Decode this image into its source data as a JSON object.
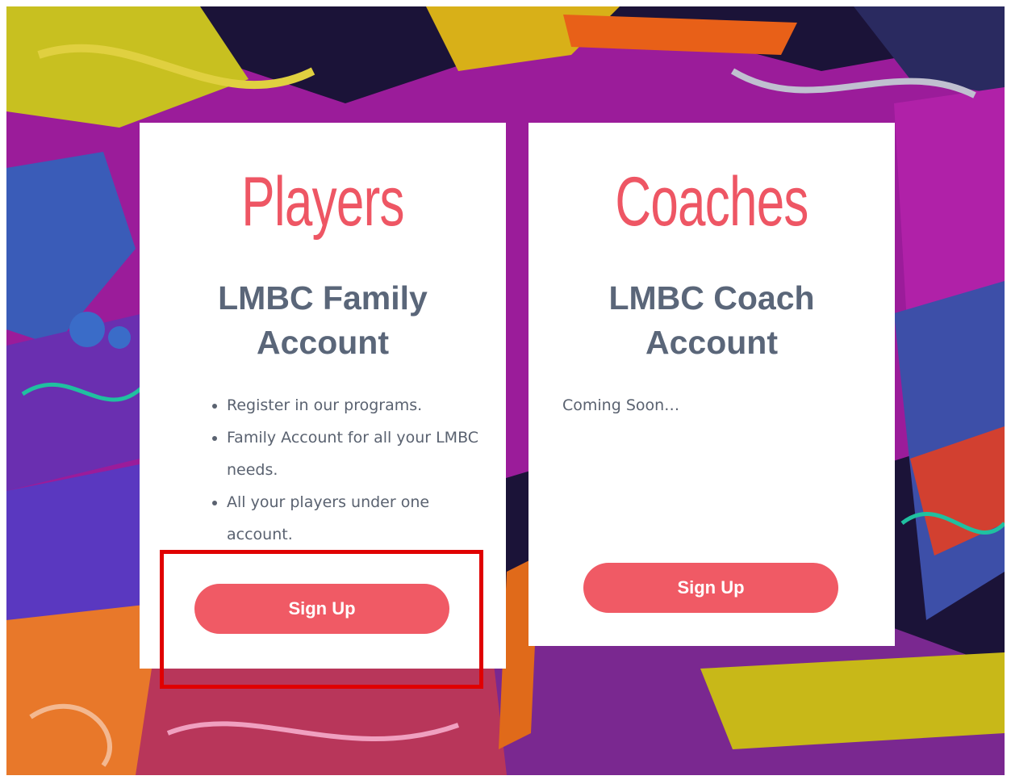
{
  "players_card": {
    "title": "Players",
    "subtitle": "LMBC Family Account",
    "features": [
      "Register in our programs.",
      "Family Account for all your LMBC needs.",
      "All your players under one account."
    ],
    "button_label": "Sign Up"
  },
  "coaches_card": {
    "title": "Coaches",
    "subtitle": "LMBC Coach Account",
    "status": "Coming Soon…",
    "button_label": "Sign Up"
  },
  "colors": {
    "accent": "#f05a65",
    "title": "#ee5664",
    "subtitle": "#5a6679",
    "highlight": "#e00000"
  }
}
